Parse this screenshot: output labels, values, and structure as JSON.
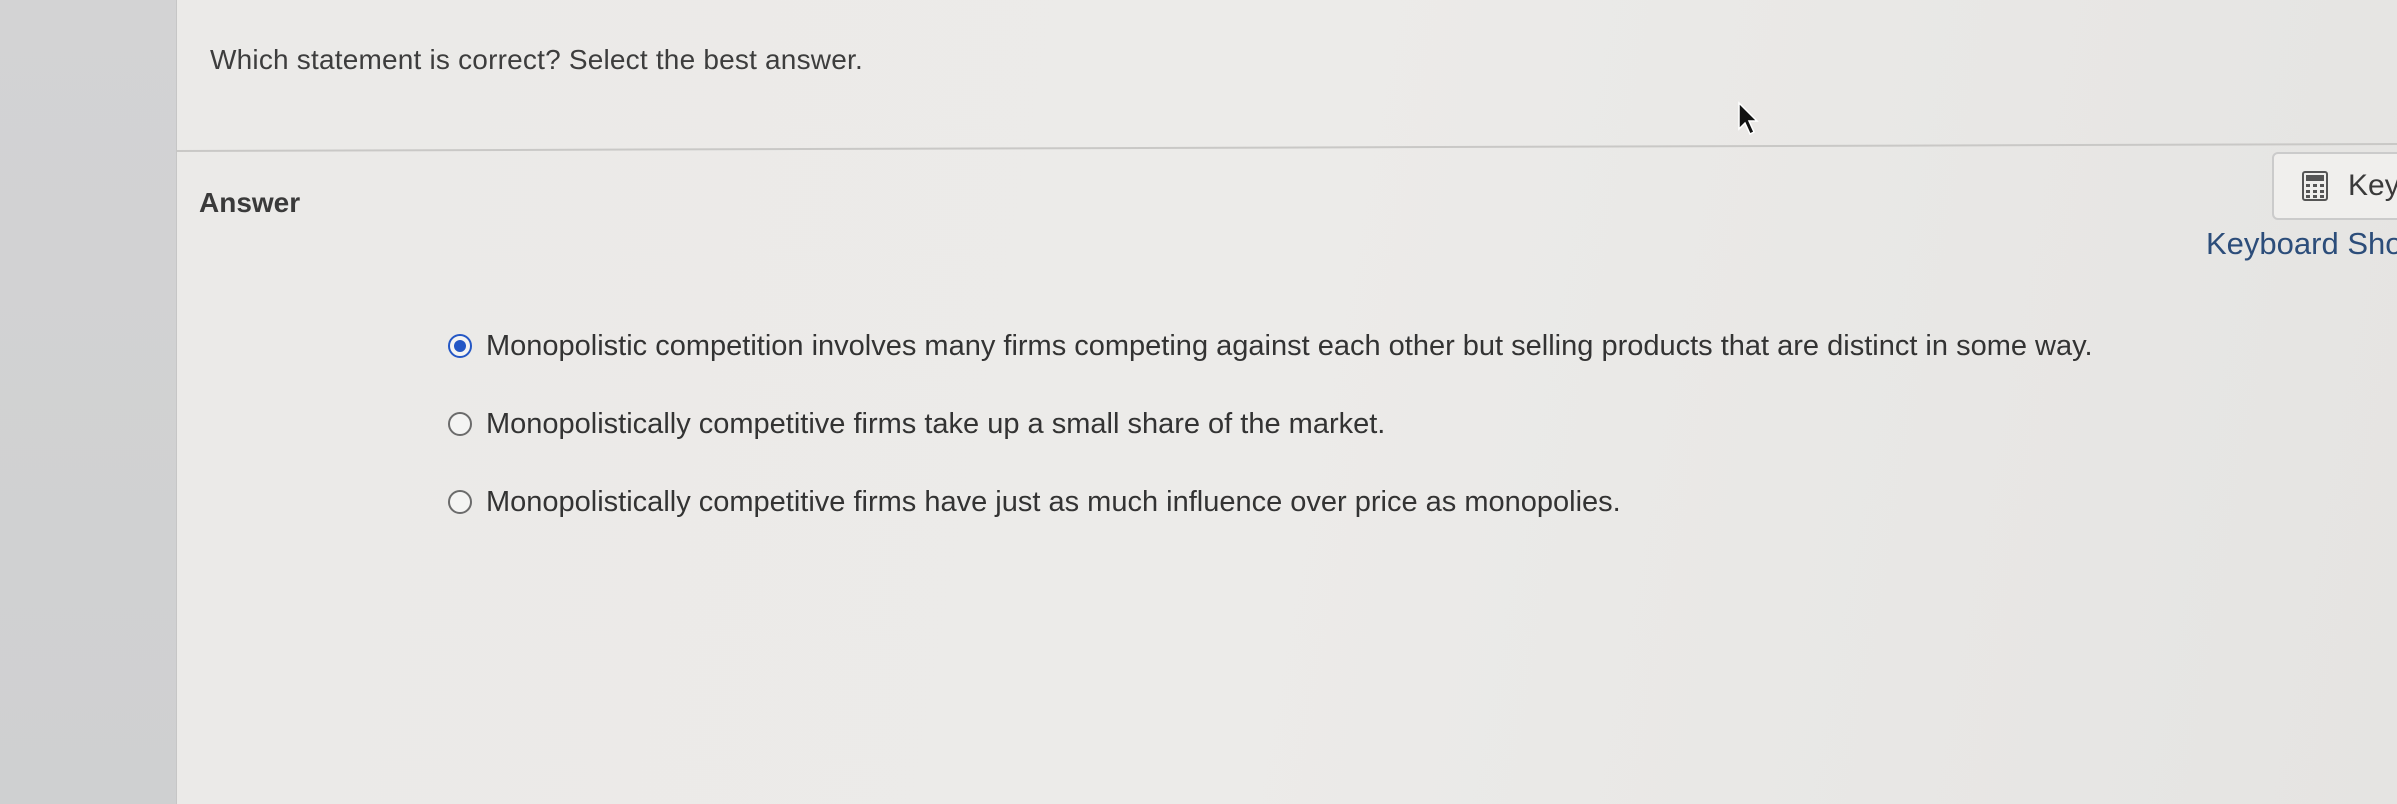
{
  "question": {
    "text": "Which statement is correct? Select the best answer."
  },
  "answer": {
    "label": "Answer",
    "options": [
      {
        "text": "Monopolistic competition involves many firms competing against each other but selling products that are distinct in some way.",
        "selected": true
      },
      {
        "text": "Monopolistically competitive firms take up a small share of the market.",
        "selected": false
      },
      {
        "text": "Monopolistically competitive firms have just as much influence over price as monopolies.",
        "selected": false
      }
    ]
  },
  "tools": {
    "calculator_label": "Key",
    "keyboard_shortcuts_label": "Keyboard Sho"
  },
  "icons": {
    "tool_button": "calculator-icon",
    "pointer": "mouse-cursor-icon"
  },
  "colors": {
    "radio_selected": "#2457c5",
    "link": "#2c4d7a"
  }
}
